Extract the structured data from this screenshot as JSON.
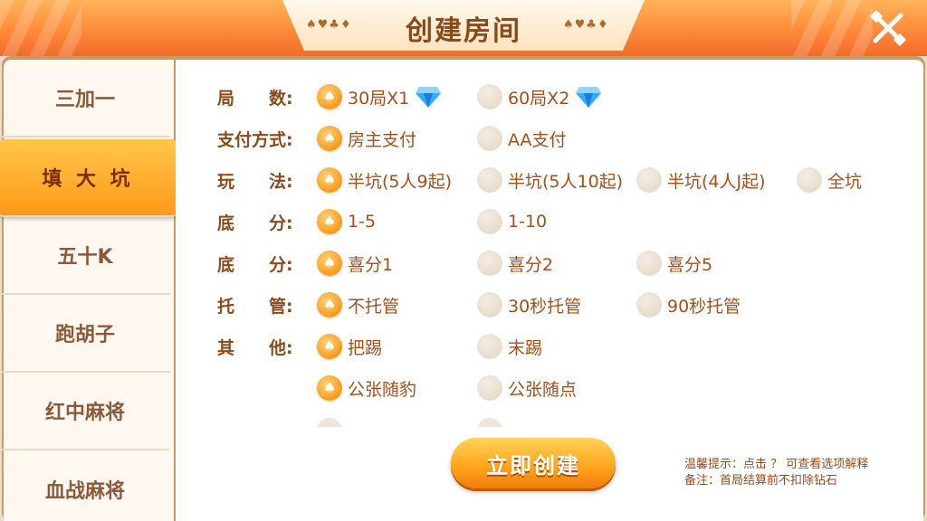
{
  "header": {
    "title": "创建房间",
    "suits_left": "♠♥♣♦",
    "suits_right": "♠♥♣♦",
    "close_icon": "close-x-icon"
  },
  "sidebar": {
    "items": [
      {
        "label": "三加一",
        "active": false
      },
      {
        "label": "填 大 坑",
        "active": true
      },
      {
        "label": "五十K",
        "active": false
      },
      {
        "label": "跑胡子",
        "active": false
      },
      {
        "label": "红中麻将",
        "active": false
      },
      {
        "label": "血战麻将",
        "active": false
      }
    ]
  },
  "rows": [
    {
      "label": "局　　数:",
      "options": [
        {
          "text": "30局X1",
          "selected": true,
          "gem": true
        },
        {
          "text": "60局X2",
          "selected": false,
          "gem": true
        }
      ]
    },
    {
      "label": "支付方式:",
      "options": [
        {
          "text": "房主支付",
          "selected": true
        },
        {
          "text": "AA支付",
          "selected": false
        }
      ]
    },
    {
      "label": "玩　　法:",
      "options": [
        {
          "text": "半坑(5人9起)",
          "selected": true
        },
        {
          "text": "半坑(5人10起)",
          "selected": false
        },
        {
          "text": "半坑(4人J起)",
          "selected": false
        },
        {
          "text": "全坑",
          "selected": false
        }
      ]
    },
    {
      "label": "底　　分:",
      "options": [
        {
          "text": "1-5",
          "selected": true
        },
        {
          "text": "1-10",
          "selected": false
        }
      ]
    },
    {
      "label": "底　　分:",
      "options": [
        {
          "text": "喜分1",
          "selected": true
        },
        {
          "text": "喜分2",
          "selected": false
        },
        {
          "text": "喜分5",
          "selected": false
        }
      ]
    },
    {
      "label": "托　　管:",
      "options": [
        {
          "text": "不托管",
          "selected": true
        },
        {
          "text": "30秒托管",
          "selected": false
        },
        {
          "text": "90秒托管",
          "selected": false
        }
      ]
    },
    {
      "label": "其　　他:",
      "options": [
        {
          "text": "把踢",
          "selected": true
        },
        {
          "text": "末踢",
          "selected": false
        }
      ]
    },
    {
      "label": "",
      "options": [
        {
          "text": "公张随豹",
          "selected": true
        },
        {
          "text": "公张随点",
          "selected": false
        }
      ]
    }
  ],
  "create_button": "立即创建",
  "tips": {
    "line1": "温馨提示：点击 ？ 可查看选项解释",
    "line2": "备注：首局结算前不扣除钻石"
  },
  "colors": {
    "accent_orange": "#ff9a1a",
    "text_brown": "#8a4a1c"
  }
}
